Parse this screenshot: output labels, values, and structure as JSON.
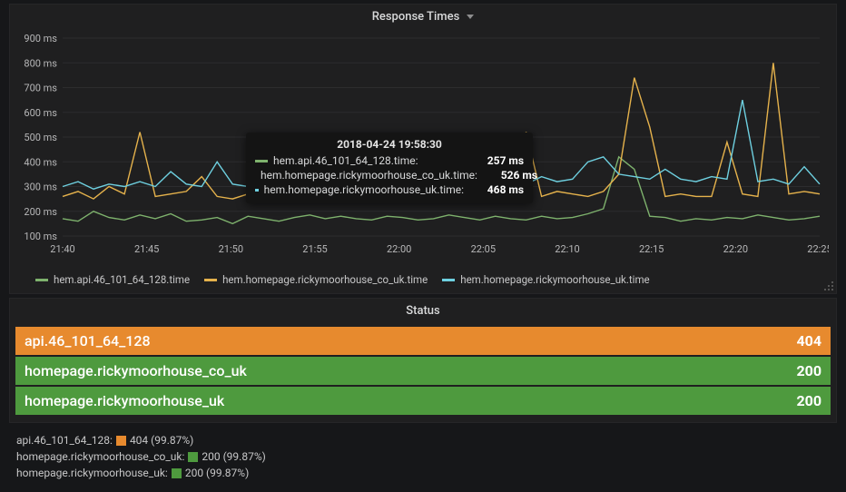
{
  "chart": {
    "title": "Response Times",
    "ylabel_unit": "ms",
    "y_ticks": [
      100,
      200,
      300,
      400,
      500,
      600,
      700,
      800,
      900
    ],
    "x_ticks": [
      "21:40",
      "21:45",
      "21:50",
      "21:55",
      "22:00",
      "22:05",
      "22:10",
      "22:15",
      "22:20",
      "22:25"
    ],
    "x_range": [
      "21:38",
      "22:28"
    ],
    "series": [
      {
        "id": "hem.api.46_101_64_128.time",
        "label": "hem.api.46_101_64_128.time",
        "color": "#7eb26d"
      },
      {
        "id": "hem.homepage.rickymoorhouse_co_uk.time",
        "label": "hem.homepage.rickymoorhouse_co_uk.time",
        "color": "#e5b24c"
      },
      {
        "id": "hem.homepage.rickymoorhouse_uk.time",
        "label": "hem.homepage.rickymoorhouse_uk.time",
        "color": "#6ed0e0"
      }
    ],
    "tooltip": {
      "time": "2018-04-24 19:58:30",
      "rows": [
        {
          "label": "hem.api.46_101_64_128.time:",
          "value": "257 ms",
          "color": "#7eb26d"
        },
        {
          "label": "hem.homepage.rickymoorhouse_co_uk.time:",
          "value": "526 ms",
          "color": "#e5b24c"
        },
        {
          "label": "hem.homepage.rickymoorhouse_uk.time:",
          "value": "468 ms",
          "color": "#6ed0e0"
        }
      ]
    }
  },
  "status": {
    "title": "Status",
    "bars": [
      {
        "name": "api.46_101_64_128",
        "value": "404",
        "class": "bar-orange"
      },
      {
        "name": "homepage.rickymoorhouse_co_uk",
        "value": "200",
        "class": "bar-green"
      },
      {
        "name": "homepage.rickymoorhouse_uk",
        "value": "200",
        "class": "bar-green"
      }
    ],
    "summary": [
      {
        "name": "api.46_101_64_128:",
        "sq": "sq-orange",
        "tail": "404 (99.87%)"
      },
      {
        "name": "homepage.rickymoorhouse_co_uk:",
        "sq": "sq-green",
        "tail": "200 (99.87%)"
      },
      {
        "name": "homepage.rickymoorhouse_uk:",
        "sq": "sq-green",
        "tail": "200 (99.87%)"
      }
    ]
  },
  "chart_data": {
    "type": "line",
    "title": "Response Times",
    "ylabel": "ms",
    "ylim": [
      100,
      900
    ],
    "x_categories": [
      "21:40",
      "21:45",
      "21:50",
      "21:55",
      "22:00",
      "22:05",
      "22:10",
      "22:15",
      "22:20",
      "22:25"
    ],
    "series": [
      {
        "name": "hem.api.46_101_64_128.time",
        "color": "#7eb26d",
        "approx_baseline_range_ms": [
          150,
          220
        ],
        "values_approx_ms": [
          170,
          160,
          200,
          175,
          165,
          185,
          170,
          190,
          160,
          165,
          175,
          150,
          180,
          170,
          160,
          175,
          185,
          170,
          180,
          170,
          165,
          180,
          175,
          165,
          170,
          185,
          175,
          165,
          180,
          170,
          165,
          180,
          170,
          175,
          190,
          210,
          420,
          370,
          180,
          175,
          160,
          170,
          165,
          175,
          170,
          185,
          175,
          165,
          170,
          180
        ]
      },
      {
        "name": "hem.homepage.rickymoorhouse_co_uk.time",
        "color": "#e5b24c",
        "approx_baseline_range_ms": [
          200,
          300
        ],
        "values_approx_ms": [
          260,
          280,
          250,
          300,
          270,
          520,
          260,
          270,
          280,
          340,
          260,
          250,
          270,
          300,
          280,
          260,
          270,
          260,
          300,
          280,
          260,
          270,
          260,
          270,
          300,
          260,
          270,
          260,
          280,
          270,
          520,
          260,
          280,
          270,
          260,
          280,
          350,
          740,
          540,
          260,
          270,
          260,
          260,
          480,
          270,
          260,
          800,
          270,
          280,
          270
        ]
      },
      {
        "name": "hem.homepage.rickymoorhouse_uk.time",
        "color": "#6ed0e0",
        "approx_baseline_range_ms": [
          250,
          340
        ],
        "values_approx_ms": [
          300,
          320,
          290,
          310,
          300,
          320,
          300,
          360,
          310,
          300,
          400,
          310,
          300,
          330,
          310,
          350,
          320,
          340,
          310,
          300,
          330,
          340,
          320,
          310,
          330,
          360,
          340,
          330,
          320,
          340,
          310,
          340,
          320,
          330,
          400,
          420,
          350,
          340,
          330,
          370,
          330,
          320,
          340,
          330,
          650,
          320,
          330,
          310,
          380,
          310
        ]
      }
    ],
    "tooltip_sample": {
      "time": "2018-04-24 19:58:30",
      "hem.api.46_101_64_128.time": 257,
      "hem.homepage.rickymoorhouse_co_uk.time": 526,
      "hem.homepage.rickymoorhouse_uk.time": 468
    }
  }
}
